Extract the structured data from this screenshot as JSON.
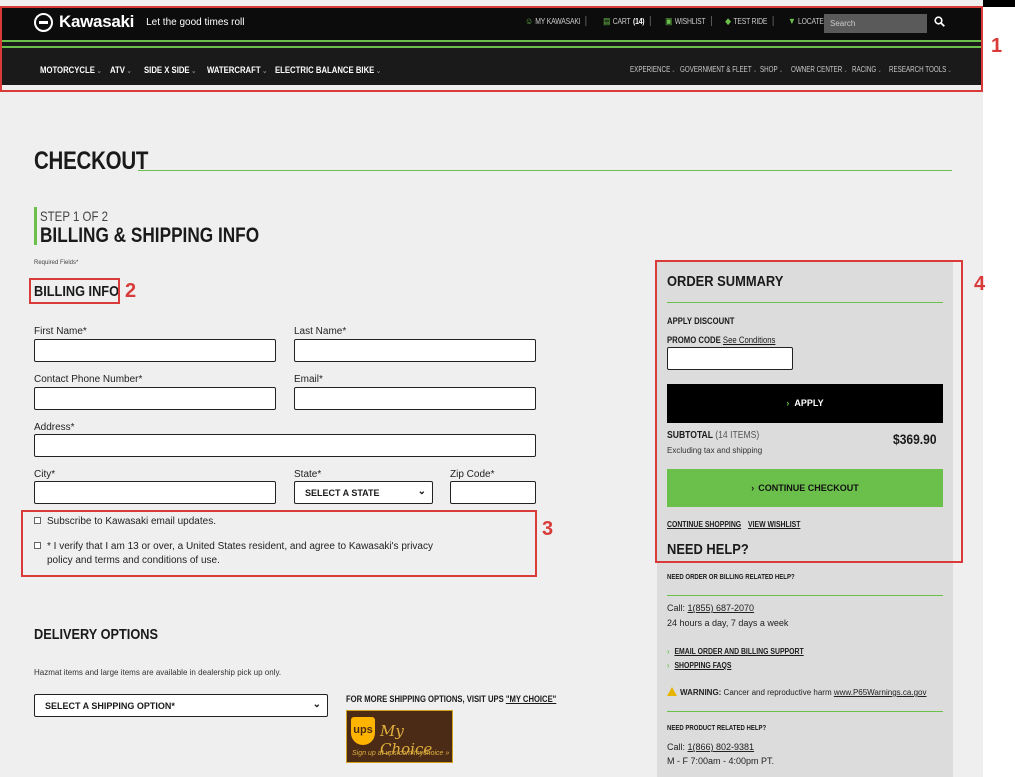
{
  "header": {
    "brand": "Kawasaki",
    "tagline": "Let the good times roll",
    "util_links": [
      {
        "icon": "user-icon",
        "glyph": "☺",
        "label": "MY KAWASAKI"
      },
      {
        "icon": "cart-icon",
        "glyph": "▤",
        "label": "CART",
        "count": "(14)"
      },
      {
        "icon": "wishlist-icon",
        "glyph": "▣",
        "label": "WISHLIST"
      },
      {
        "icon": "test-ride-icon",
        "glyph": "◆",
        "label": "TEST RIDE"
      },
      {
        "icon": "location-pin-icon",
        "glyph": "▼",
        "label": "LOCATE A DEALER"
      }
    ],
    "search_placeholder": "Search",
    "main_nav": [
      "MOTORCYCLE",
      "ATV",
      "SIDE X SIDE",
      "WATERCRAFT",
      "ELECTRIC BALANCE BIKE"
    ],
    "secondary_nav": [
      "EXPERIENCE",
      "GOVERNMENT & FLEET",
      "SHOP",
      "OWNER CENTER",
      "RACING",
      "RESEARCH TOOLS"
    ]
  },
  "annotations": [
    "1",
    "2",
    "3",
    "4"
  ],
  "checkout": {
    "title": "CHECKOUT",
    "step_label": "STEP 1 OF 2",
    "step_title": "BILLING & SHIPPING INFO",
    "required_note": "Required Fields*"
  },
  "billing": {
    "heading": "BILLING INFO",
    "first_name_label": "First Name*",
    "last_name_label": "Last Name*",
    "phone_label": "Contact Phone Number*",
    "email_label": "Email*",
    "address_label": "Address*",
    "city_label": "City*",
    "state_label": "State*",
    "state_value": "SELECT A STATE",
    "zip_label": "Zip Code*",
    "subscribe_label": "Subscribe to Kawasaki email updates.",
    "verify_line1": "* I verify that I am 13 or over, a United States resident, and agree to Kawasaki's privacy",
    "verify_line2": "policy and terms and conditions of use."
  },
  "delivery": {
    "heading": "DELIVERY OPTIONS",
    "note": "Hazmat items and large items are available in dealership pick up only.",
    "select_value": "SELECT A SHIPPING OPTION*",
    "more_options_prefix": "FOR MORE SHIPPING OPTIONS, VISIT UPS ",
    "more_options_link": "\"MY CHOICE\"",
    "ups_logo_text": "ups",
    "ups_brand": "My Choice",
    "ups_signup": "Sign up at ups.com/mychoice »"
  },
  "order_summary": {
    "title": "ORDER SUMMARY",
    "apply_discount": "APPLY DISCOUNT",
    "promo_label": "PROMO CODE",
    "see_conditions": "See Conditions",
    "apply_button": "APPLY",
    "subtotal_label": "SUBTOTAL",
    "subtotal_items": "(14 ITEMS)",
    "excluding": "Excluding tax and shipping",
    "subtotal_value": "$369.90",
    "continue_button": "CONTINUE CHECKOUT",
    "continue_shopping": "CONTINUE SHOPPING",
    "view_wishlist": "VIEW WISHLIST"
  },
  "help": {
    "title": "NEED HELP?",
    "order_heading": "NEED ORDER OR BILLING RELATED HELP?",
    "call_prefix": "Call: ",
    "order_phone": "1(855) 687-2070",
    "order_hours": "24 hours a day, 7 days a week",
    "email_support": "EMAIL ORDER AND BILLING SUPPORT",
    "shopping_faqs": "SHOPPING FAQS",
    "warning_label": "WARNING:",
    "warning_text": " Cancer and reproductive harm ",
    "warning_link": "www.P65Warnings.ca.gov",
    "product_heading": "NEED PRODUCT RELATED HELP?",
    "product_phone": "1(866) 802-9381",
    "product_hours": "M - F 7:00am - 4:00pm PT."
  },
  "colors": {
    "accent": "#6bc04b",
    "annotation": "#d93a3a",
    "dark": "#1a1a1a"
  }
}
